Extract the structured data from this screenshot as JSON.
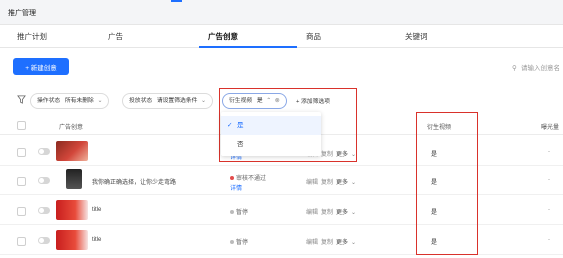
{
  "header": {
    "title": "推广管理"
  },
  "tabs": [
    {
      "label": "推广计划",
      "active": false
    },
    {
      "label": "广告",
      "active": false
    },
    {
      "label": "广告创意",
      "active": true
    },
    {
      "label": "商品",
      "active": false
    },
    {
      "label": "关键词",
      "active": false
    }
  ],
  "toolbar": {
    "new_button": "+ 新建创意",
    "search_placeholder": "请输入创意名"
  },
  "filters": {
    "op_status": {
      "label": "操作状态",
      "value": "所有未删除"
    },
    "delivery_status": {
      "label": "投放状态",
      "value": "请设置筛选条件"
    },
    "derived_video": {
      "label": "衍生视频",
      "value": "是"
    },
    "add_filter": "+ 添加筛选项"
  },
  "dropdown": {
    "options": [
      {
        "label": "是",
        "selected": true
      },
      {
        "label": "否",
        "selected": false
      }
    ]
  },
  "table": {
    "headers": {
      "creative": "广告创意",
      "derived_video": "衍生视频",
      "impressions": "曝光量"
    },
    "ops": {
      "edit": "编辑",
      "copy": "复制",
      "more": "更多"
    },
    "rows": [
      {
        "name": "",
        "status": "",
        "detail": "详情",
        "derived": "是",
        "impressions": "-"
      },
      {
        "name": "我你确正确选择，让你少走弯路",
        "status": "审核不通过",
        "detail": "详情",
        "derived": "是",
        "impressions": "-"
      },
      {
        "name": "title",
        "status": "暂停",
        "detail": "",
        "derived": "是",
        "impressions": "-"
      },
      {
        "name": "title",
        "status": "暂停",
        "detail": "",
        "derived": "是",
        "impressions": "-"
      }
    ]
  },
  "colors": {
    "accent": "#1e6fff",
    "highlight": "#d9322b",
    "reject": "#e34d4d"
  }
}
